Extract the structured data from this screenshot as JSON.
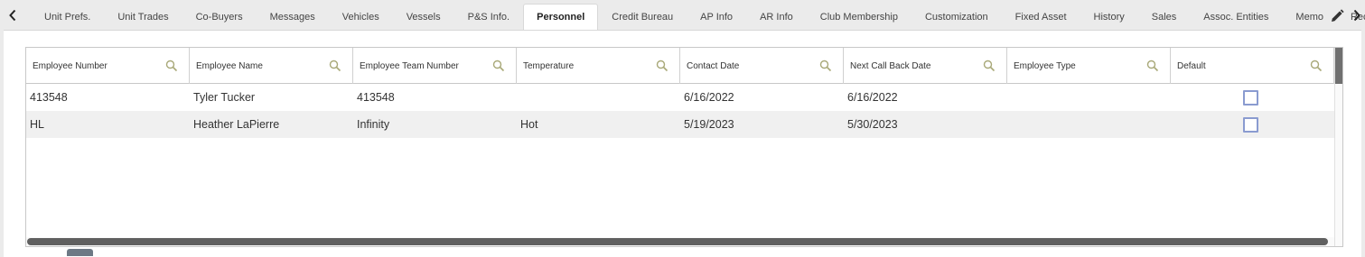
{
  "tabs": [
    {
      "label": "Unit Prefs.",
      "active": false
    },
    {
      "label": "Unit Trades",
      "active": false
    },
    {
      "label": "Co-Buyers",
      "active": false
    },
    {
      "label": "Messages",
      "active": false
    },
    {
      "label": "Vehicles",
      "active": false
    },
    {
      "label": "Vessels",
      "active": false
    },
    {
      "label": "P&S Info.",
      "active": false
    },
    {
      "label": "Personnel",
      "active": true
    },
    {
      "label": "Credit Bureau",
      "active": false
    },
    {
      "label": "AP Info",
      "active": false
    },
    {
      "label": "AR Info",
      "active": false
    },
    {
      "label": "Club Membership",
      "active": false
    },
    {
      "label": "Customization",
      "active": false
    },
    {
      "label": "Fixed Asset",
      "active": false
    },
    {
      "label": "History",
      "active": false
    },
    {
      "label": "Sales",
      "active": false
    },
    {
      "label": "Assoc. Entities",
      "active": false
    },
    {
      "label": "Memo",
      "active": false
    },
    {
      "label": "Reception",
      "active": false
    }
  ],
  "grid": {
    "columns": [
      "Employee Number",
      "Employee Name",
      "Employee Team Number",
      "Temperature",
      "Contact Date",
      "Next Call Back Date",
      "Employee Type",
      "Default"
    ],
    "rows": [
      {
        "employee_number": "413548",
        "employee_name": "Tyler Tucker",
        "team_number": "413548",
        "temperature": "",
        "contact_date": "6/16/2022",
        "next_call_back_date": "6/16/2022",
        "employee_type": "",
        "default": false
      },
      {
        "employee_number": "HL",
        "employee_name": "Heather LaPierre",
        "team_number": "Infinity",
        "temperature": "Hot",
        "contact_date": "5/19/2023",
        "next_call_back_date": "5/30/2023",
        "employee_type": "",
        "default": false
      }
    ]
  },
  "icons": {
    "prev": "chevron-left-icon",
    "next": "chevron-right-icon",
    "edit": "pencil-icon",
    "search": "search-icon"
  },
  "colors": {
    "search_icon": "#a8a878",
    "checkbox_border": "#8a9bd0",
    "scrollbar": "#606060",
    "alt_row": "#f0f0f0"
  }
}
